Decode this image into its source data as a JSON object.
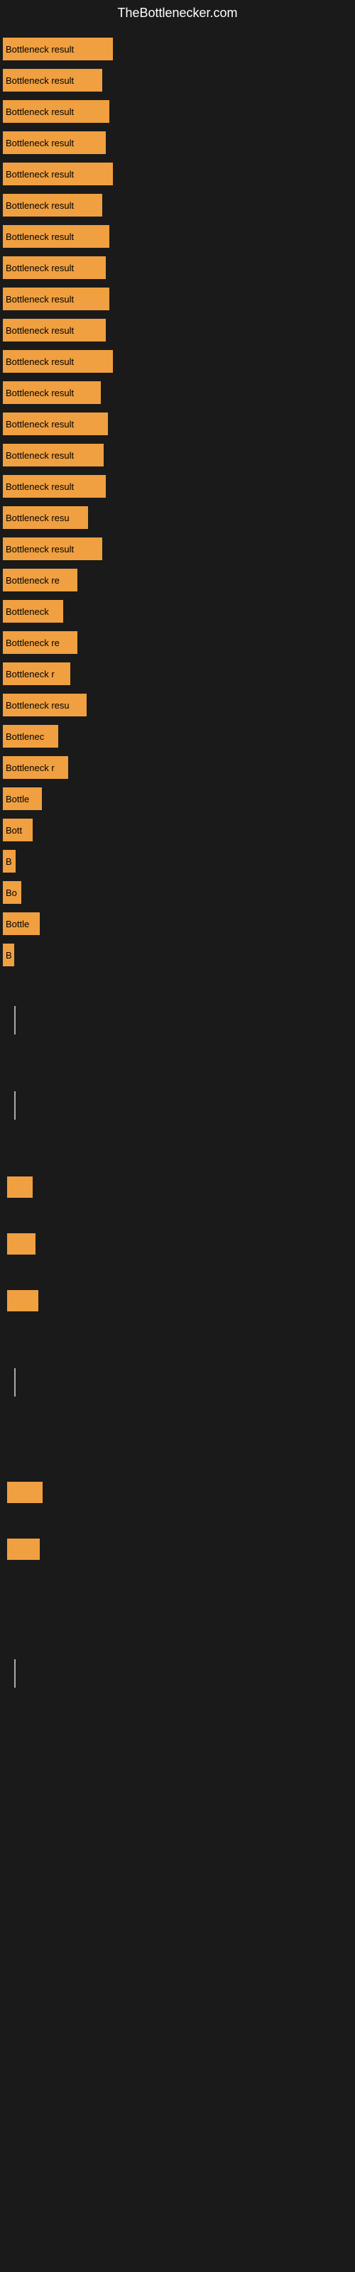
{
  "site": {
    "title": "TheBottlenecker.com"
  },
  "bars": [
    {
      "id": 1,
      "label": "Bottleneck result",
      "width": 155
    },
    {
      "id": 2,
      "label": "Bottleneck result",
      "width": 140
    },
    {
      "id": 3,
      "label": "Bottleneck result",
      "width": 150
    },
    {
      "id": 4,
      "label": "Bottleneck result",
      "width": 145
    },
    {
      "id": 5,
      "label": "Bottleneck result",
      "width": 155
    },
    {
      "id": 6,
      "label": "Bottleneck result",
      "width": 140
    },
    {
      "id": 7,
      "label": "Bottleneck result",
      "width": 150
    },
    {
      "id": 8,
      "label": "Bottleneck result",
      "width": 145
    },
    {
      "id": 9,
      "label": "Bottleneck result",
      "width": 150
    },
    {
      "id": 10,
      "label": "Bottleneck result",
      "width": 145
    },
    {
      "id": 11,
      "label": "Bottleneck result",
      "width": 155
    },
    {
      "id": 12,
      "label": "Bottleneck result",
      "width": 138
    },
    {
      "id": 13,
      "label": "Bottleneck result",
      "width": 148
    },
    {
      "id": 14,
      "label": "Bottleneck result",
      "width": 142
    },
    {
      "id": 15,
      "label": "Bottleneck result",
      "width": 145
    },
    {
      "id": 16,
      "label": "Bottleneck resu",
      "width": 120
    },
    {
      "id": 17,
      "label": "Bottleneck result",
      "width": 140
    },
    {
      "id": 18,
      "label": "Bottleneck re",
      "width": 105
    },
    {
      "id": 19,
      "label": "Bottleneck",
      "width": 85
    },
    {
      "id": 20,
      "label": "Bottleneck re",
      "width": 105
    },
    {
      "id": 21,
      "label": "Bottleneck r",
      "width": 95
    },
    {
      "id": 22,
      "label": "Bottleneck resu",
      "width": 118
    },
    {
      "id": 23,
      "label": "Bottlenec",
      "width": 78
    },
    {
      "id": 24,
      "label": "Bottleneck r",
      "width": 92
    },
    {
      "id": 25,
      "label": "Bottle",
      "width": 55
    },
    {
      "id": 26,
      "label": "Bott",
      "width": 42
    },
    {
      "id": 27,
      "label": "B",
      "width": 18
    },
    {
      "id": 28,
      "label": "Bo",
      "width": 26
    },
    {
      "id": 29,
      "label": "Bottle",
      "width": 52
    },
    {
      "id": 30,
      "label": "B",
      "width": 16
    }
  ],
  "colors": {
    "bar_fill": "#f0a040",
    "background": "#1a1a1a",
    "title_text": "#ffffff",
    "bar_text": "#000000"
  }
}
